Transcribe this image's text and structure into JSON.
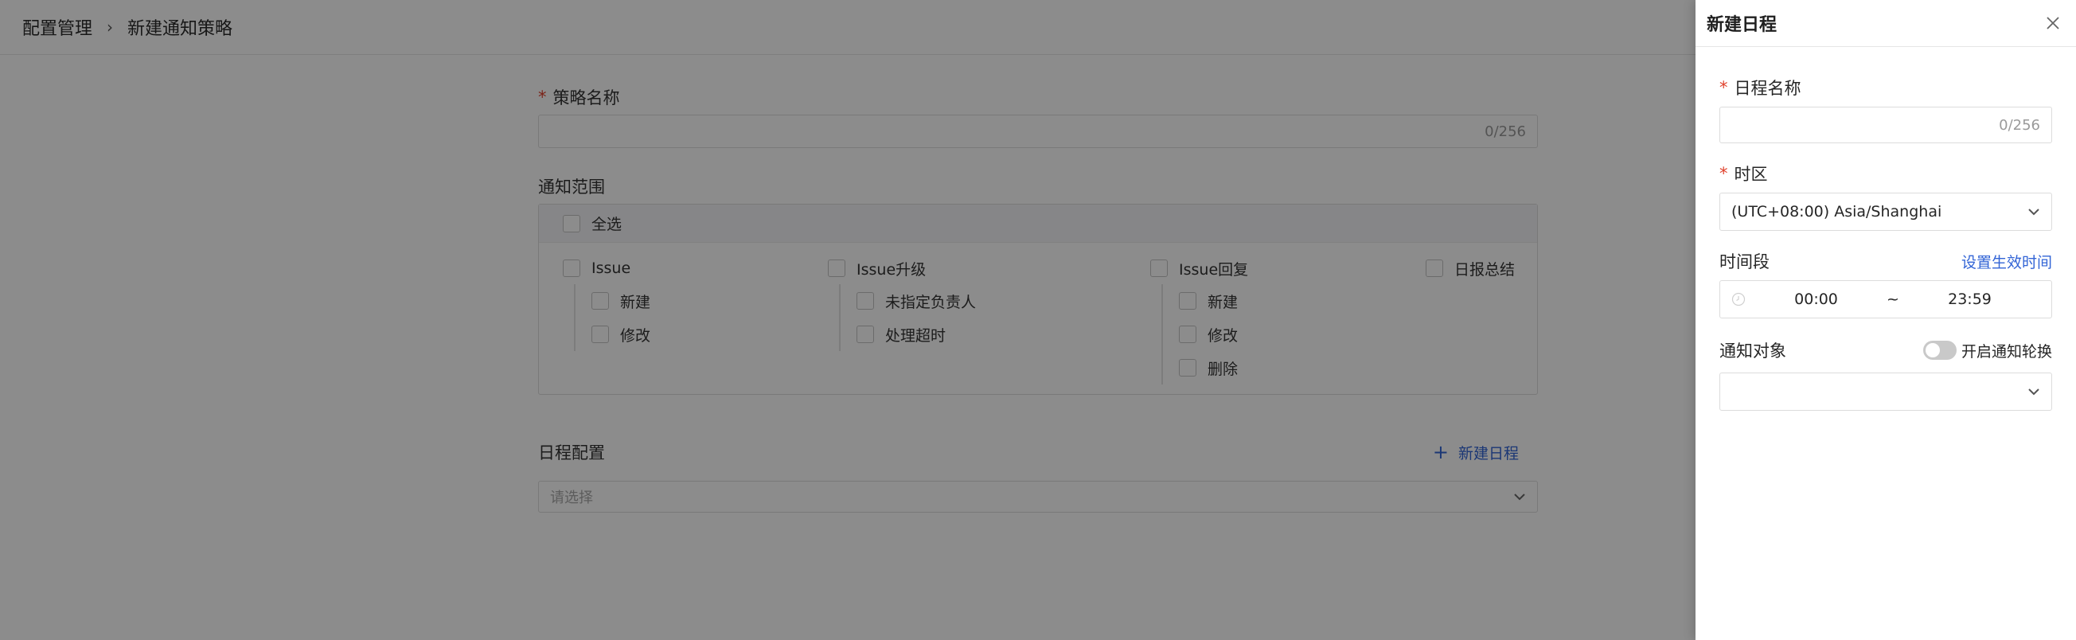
{
  "breadcrumb": {
    "parent": "配置管理",
    "current": "新建通知策略"
  },
  "policy_form": {
    "name_label": "策略名称",
    "name_counter": "0/256",
    "scope_label": "通知范围",
    "select_all_label": "全选",
    "groups": [
      {
        "label": "Issue",
        "children": [
          "新建",
          "修改"
        ]
      },
      {
        "label": "Issue升级",
        "children": [
          "未指定负责人",
          "处理超时"
        ]
      },
      {
        "label": "Issue回复",
        "children": [
          "新建",
          "修改",
          "删除"
        ]
      },
      {
        "label": "日报总结",
        "children": []
      }
    ],
    "schedule_label": "日程配置",
    "add_schedule_label": "新建日程",
    "schedule_placeholder": "请选择"
  },
  "drawer": {
    "title": "新建日程",
    "name_label": "日程名称",
    "name_counter": "0/256",
    "timezone_label": "时区",
    "timezone_value": "(UTC+08:00) Asia/Shanghai",
    "period_label": "时间段",
    "set_time_link": "设置生效时间",
    "time_start": "00:00",
    "time_sep": "~",
    "time_end": "23:59",
    "target_label": "通知对象",
    "rotation_label": "开启通知轮换",
    "rotation_enabled": false
  },
  "colors": {
    "accent": "#3264d6",
    "required": "#e0412c"
  },
  "icons": [
    "chevron-right-icon",
    "checkbox-icon",
    "plus-icon",
    "chevron-down-icon",
    "close-icon",
    "clock-icon",
    "toggle-switch"
  ]
}
